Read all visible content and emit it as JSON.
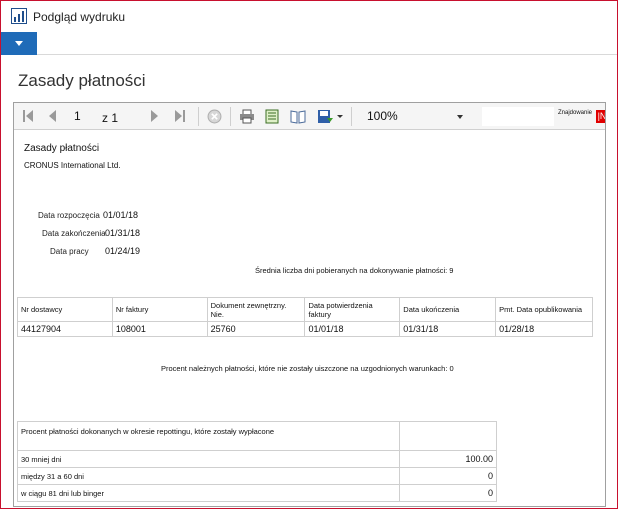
{
  "app": {
    "title": "Podgląd wydruku"
  },
  "page_title": "Zasady płatności",
  "toolbar": {
    "current_page": "1",
    "page_of": "z 1",
    "zoom": "100%",
    "find_label": "Znajdowanie",
    "next_label": "|N"
  },
  "report": {
    "title": "Zasady płatności",
    "company": "CRONUS International Ltd.",
    "fields": [
      {
        "label": "Data rozpoczęcia",
        "value": "01/01/18"
      },
      {
        "label": "Data zakończenia",
        "value": "01/31/18"
      },
      {
        "label": "Data pracy",
        "value": "01/24/19"
      }
    ],
    "avg_days": "Średnia liczba dni pobieranych na dokonywanie płatności: 9",
    "table": {
      "headers": [
        "Nr dostawcy",
        "Nr faktury",
        "Dokument zewnętrzny. Nie.",
        "Data potwierdzenia faktury",
        "Data ukończenia",
        "Pmt. Data opublikowania"
      ],
      "row": [
        "44127904",
        "108001",
        "25760",
        "01/01/18",
        "01/31/18",
        "01/28/18"
      ]
    },
    "unpaid_note": "Procent należnych płatności, które nie zostały uiszczone na uzgodnionych warunkach: 0",
    "payments": {
      "header": "Procent płatności dokonanych w okresie repottingu, które zostały wypłacone",
      "rows": [
        {
          "label": "30 mniej dni",
          "value": "100.00"
        },
        {
          "label": "między 31 a 60 dni",
          "value": "0"
        },
        {
          "label": "w ciągu 81 dni lub binger",
          "value": "0"
        }
      ]
    }
  }
}
